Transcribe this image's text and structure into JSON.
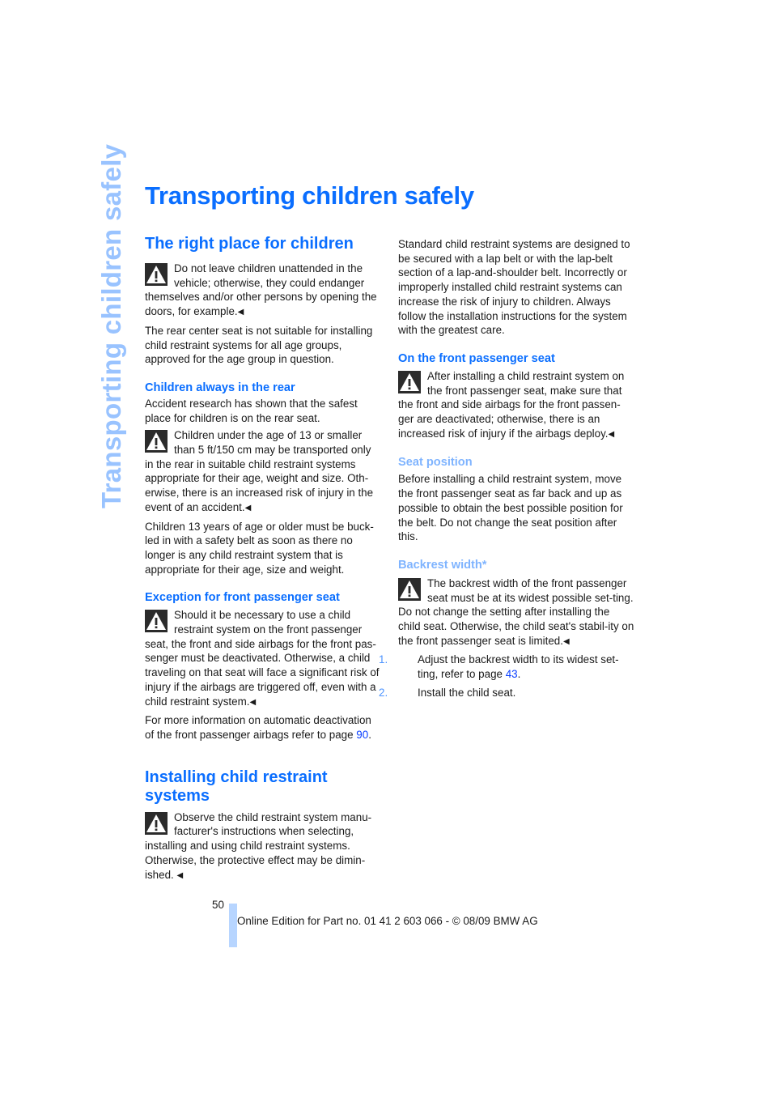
{
  "side_tab": "Transporting children safely",
  "page_title": "Transporting children safely",
  "left": {
    "section1": {
      "title": "The right place for children",
      "warning1": "Do not leave children unattended in the vehicle; otherwise, they could endanger themselves and/or other persons by opening the doors, for example.",
      "para1": "The rear center seat is not suitable for installing child restraint systems for all age groups, approved for the age group in question."
    },
    "sub1": {
      "title": "Children always in the rear",
      "para1": "Accident research has shown that the safest place for children is on the rear seat.",
      "warning1": "Children under the age of 13 or smaller than 5 ft/150 cm may be transported only in the rear in suitable child restraint systems appropriate for their age, weight and size. Oth-erwise, there is an increased risk of injury in the event of an accident.",
      "para2": "Children 13 years of age or older must be buck-led in with a safety belt as soon as there no longer is any child restraint system that is appropriate for their age, size and weight."
    },
    "sub2": {
      "title": "Exception for front passenger seat",
      "warning1": "Should it be necessary to use a child restraint system on the front passenger seat, the front and side airbags for the front pas-senger must be deactivated. Otherwise, a child traveling on that seat will face a significant risk of injury if the airbags are triggered off, even with a child restraint system.",
      "para1_prefix": "For more information on automatic deactivation of the front passenger airbags refer to page ",
      "para1_link": "90",
      "para1_suffix": "."
    },
    "section2": {
      "title": "Installing child restraint systems",
      "warning1": "Observe the child restraint system manu-facturer's instructions when selecting, installing and using child restraint systems. Otherwise, the protective effect may be dimin-ished. "
    }
  },
  "right": {
    "para1": "Standard child restraint systems are designed to be secured with a lap belt or with the lap-belt section of a lap-and-shoulder belt. Incorrectly or improperly installed child restraint systems can increase the risk of injury to children. Always follow the installation instructions for the system with the greatest care.",
    "sub1": {
      "title": "On the front passenger seat",
      "warning1": "After installing a child restraint system on the front passenger seat, make sure that the front and side airbags for the front passen-ger are deactivated; otherwise, there is an increased risk of injury if the airbags deploy."
    },
    "sub2": {
      "title": "Seat position",
      "para1": "Before installing a child restraint system, move the front passenger seat as far back and up as possible to obtain the best possible position for the belt. Do not change the seat position after this."
    },
    "sub3": {
      "title": "Backrest width*",
      "warning1": "The backrest width of the front passenger seat must be at its widest possible set-ting. Do not change the setting after installing the child seat. Otherwise, the child seat's stabil-ity on the front passenger seat is limited.",
      "steps": [
        {
          "num": "1.",
          "text": "Adjust the backrest width to its widest set-ting, refer to page ",
          "link": "43",
          "suffix": "."
        },
        {
          "num": "2.",
          "text": "Install the child seat."
        }
      ]
    }
  },
  "end_mark": "◀",
  "footer": {
    "page_number": "50",
    "text": "Online Edition for Part no. 01 41 2 603 066 - © 08/09 BMW AG"
  },
  "colors": {
    "accent": "#0a6eff",
    "accent_light": "#7fb4ff",
    "side_tab": "#99c3ff",
    "link": "#0a3fff"
  }
}
